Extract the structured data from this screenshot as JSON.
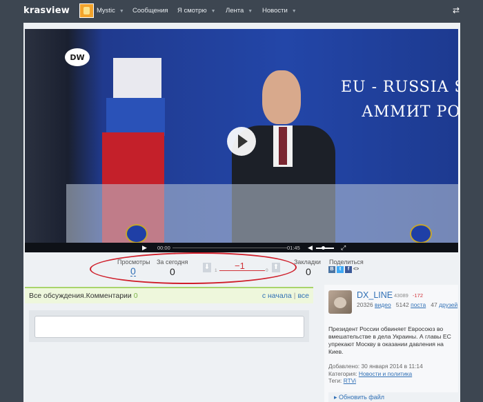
{
  "site": {
    "logo": "krasview"
  },
  "nav": {
    "user_label": "Mystic",
    "items": [
      "Сообщения",
      "Я смотрю",
      "Лента",
      "Новости"
    ]
  },
  "video": {
    "channel_logo": "DW",
    "banner_line1": "EU - RUSSIA SU",
    "banner_line2": "АММИТ РОСС",
    "time_current": "00:00",
    "time_total": "01:45"
  },
  "stats": {
    "views_label": "Просмотры",
    "views_value": "0",
    "today_label": "За сегодня",
    "today_value": "0",
    "rating_value": "−1",
    "rating_min": "1",
    "rating_max": "0",
    "bookmarks_label": "Закладки",
    "bookmarks_value": "0",
    "share_label": "Поделиться"
  },
  "discussion": {
    "title_prefix": "Все обсуждения.",
    "title_section": "Комментарии",
    "count": "0",
    "link_start": "с начала",
    "link_all": "все"
  },
  "author": {
    "name": "DX_LINE",
    "score": "43089",
    "karma": "-172",
    "videos_count": "20326",
    "videos_label": "видео",
    "posts_count": "5142",
    "posts_label": "поста",
    "friends_count": "47",
    "friends_label": "друзей"
  },
  "description": "Президент России обвиняет Евросоюз во вмешательстве в дела Украины. А главы ЕС упрекают Москву в оказании давления на Киев.",
  "meta": {
    "added_label": "Добавлено:",
    "added_value": "30 января 2014 в 11:14",
    "category_label": "Категория:",
    "category_value": "Новости и политика",
    "tags_label": "Теги:",
    "tags_value": "RTVi"
  },
  "update_file_label": "Обновить файл",
  "colors": {
    "accent_blue": "#2f6fb5",
    "rating_red": "#d03036",
    "highlight_circle": "#cf1e2a",
    "green_bar": "#a8d46a"
  }
}
